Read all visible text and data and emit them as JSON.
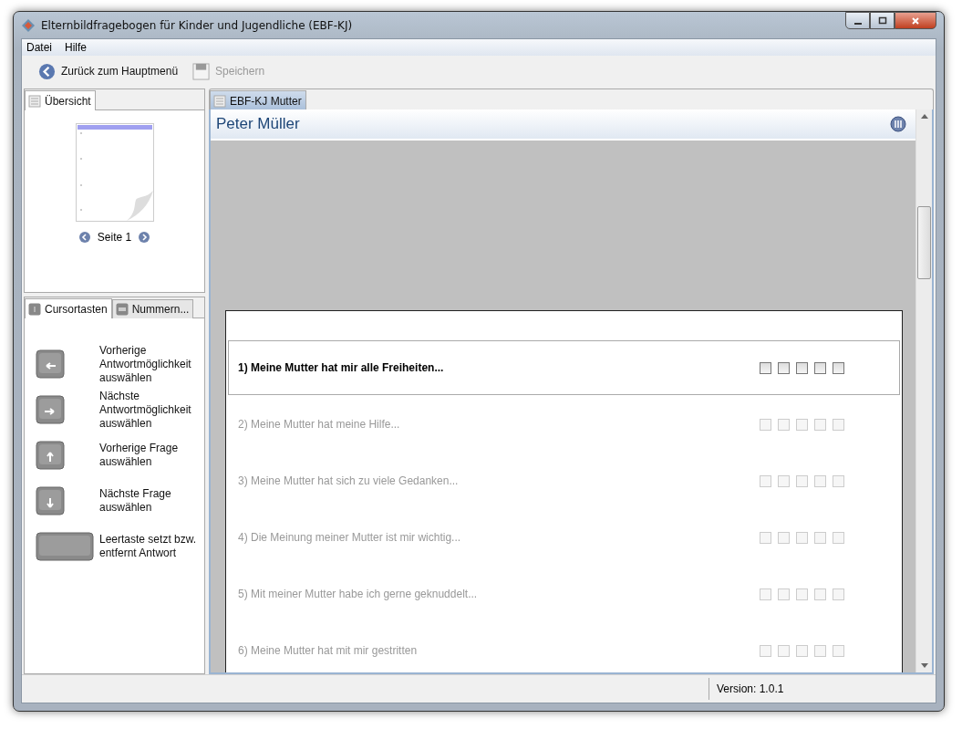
{
  "window": {
    "title": "Elternbildfragebogen für Kinder und Jugendliche (EBF-KJ)"
  },
  "menu": [
    "Datei",
    "Hilfe"
  ],
  "toolbar": [
    {
      "kind": "back",
      "label": "Zurück zum Hauptmenü",
      "disabled": false
    },
    {
      "kind": "save",
      "label": "Speichern",
      "disabled": true
    }
  ],
  "overview": {
    "tab": {
      "label": "Übersicht",
      "selected": true
    },
    "page_label": "Seite 1"
  },
  "key_tabs": [
    {
      "label": "Cursortasten",
      "kind": "cursor",
      "selected": true
    },
    {
      "label": "Nummern...",
      "kind": "number",
      "selected": false
    }
  ],
  "keys": [
    {
      "kind": "left",
      "text": "Vorherige Antwortmöglichkeit auswählen"
    },
    {
      "kind": "right",
      "text": "Nächste Antwortmöglichkeit auswählen"
    },
    {
      "kind": "up",
      "text": "Vorherige Frage auswählen"
    },
    {
      "kind": "down",
      "text": "Nächste Frage auswählen"
    },
    {
      "kind": "space",
      "text": "Leertaste setzt bzw. entfernt Antwort"
    }
  ],
  "document_tab": {
    "label": "EBF-KJ Mutter",
    "selected": true
  },
  "person": "Peter Müller",
  "questions": [
    {
      "text": "1) Meine Mutter hat mir alle Freiheiten...",
      "selected": true,
      "options": [
        {
          "checked": false
        },
        {
          "checked": false
        },
        {
          "checked": false
        },
        {
          "checked": false
        },
        {
          "checked": false
        }
      ]
    },
    {
      "text": "2) Meine Mutter hat meine Hilfe...",
      "selected": false,
      "options": [
        {
          "checked": false
        },
        {
          "checked": false
        },
        {
          "checked": false
        },
        {
          "checked": false
        },
        {
          "checked": false
        }
      ]
    },
    {
      "text": "3) Meine Mutter hat sich zu viele Gedanken...",
      "selected": false,
      "options": [
        {
          "checked": false
        },
        {
          "checked": false
        },
        {
          "checked": false
        },
        {
          "checked": false
        },
        {
          "checked": false
        }
      ]
    },
    {
      "text": "4) Die Meinung meiner Mutter ist mir wichtig...",
      "selected": false,
      "options": [
        {
          "checked": false
        },
        {
          "checked": false
        },
        {
          "checked": false
        },
        {
          "checked": false
        },
        {
          "checked": false
        }
      ]
    },
    {
      "text": "5) Mit meiner Mutter habe ich gerne geknuddelt...",
      "selected": false,
      "options": [
        {
          "checked": false
        },
        {
          "checked": false
        },
        {
          "checked": false
        },
        {
          "checked": false
        },
        {
          "checked": false
        }
      ]
    },
    {
      "text": "6) Meine Mutter hat mit mir gestritten",
      "selected": false,
      "options": [
        {
          "checked": false
        },
        {
          "checked": false
        },
        {
          "checked": false
        },
        {
          "checked": false
        },
        {
          "checked": false
        }
      ]
    }
  ],
  "status_bar": {
    "version": "Version: 1.0.1"
  }
}
